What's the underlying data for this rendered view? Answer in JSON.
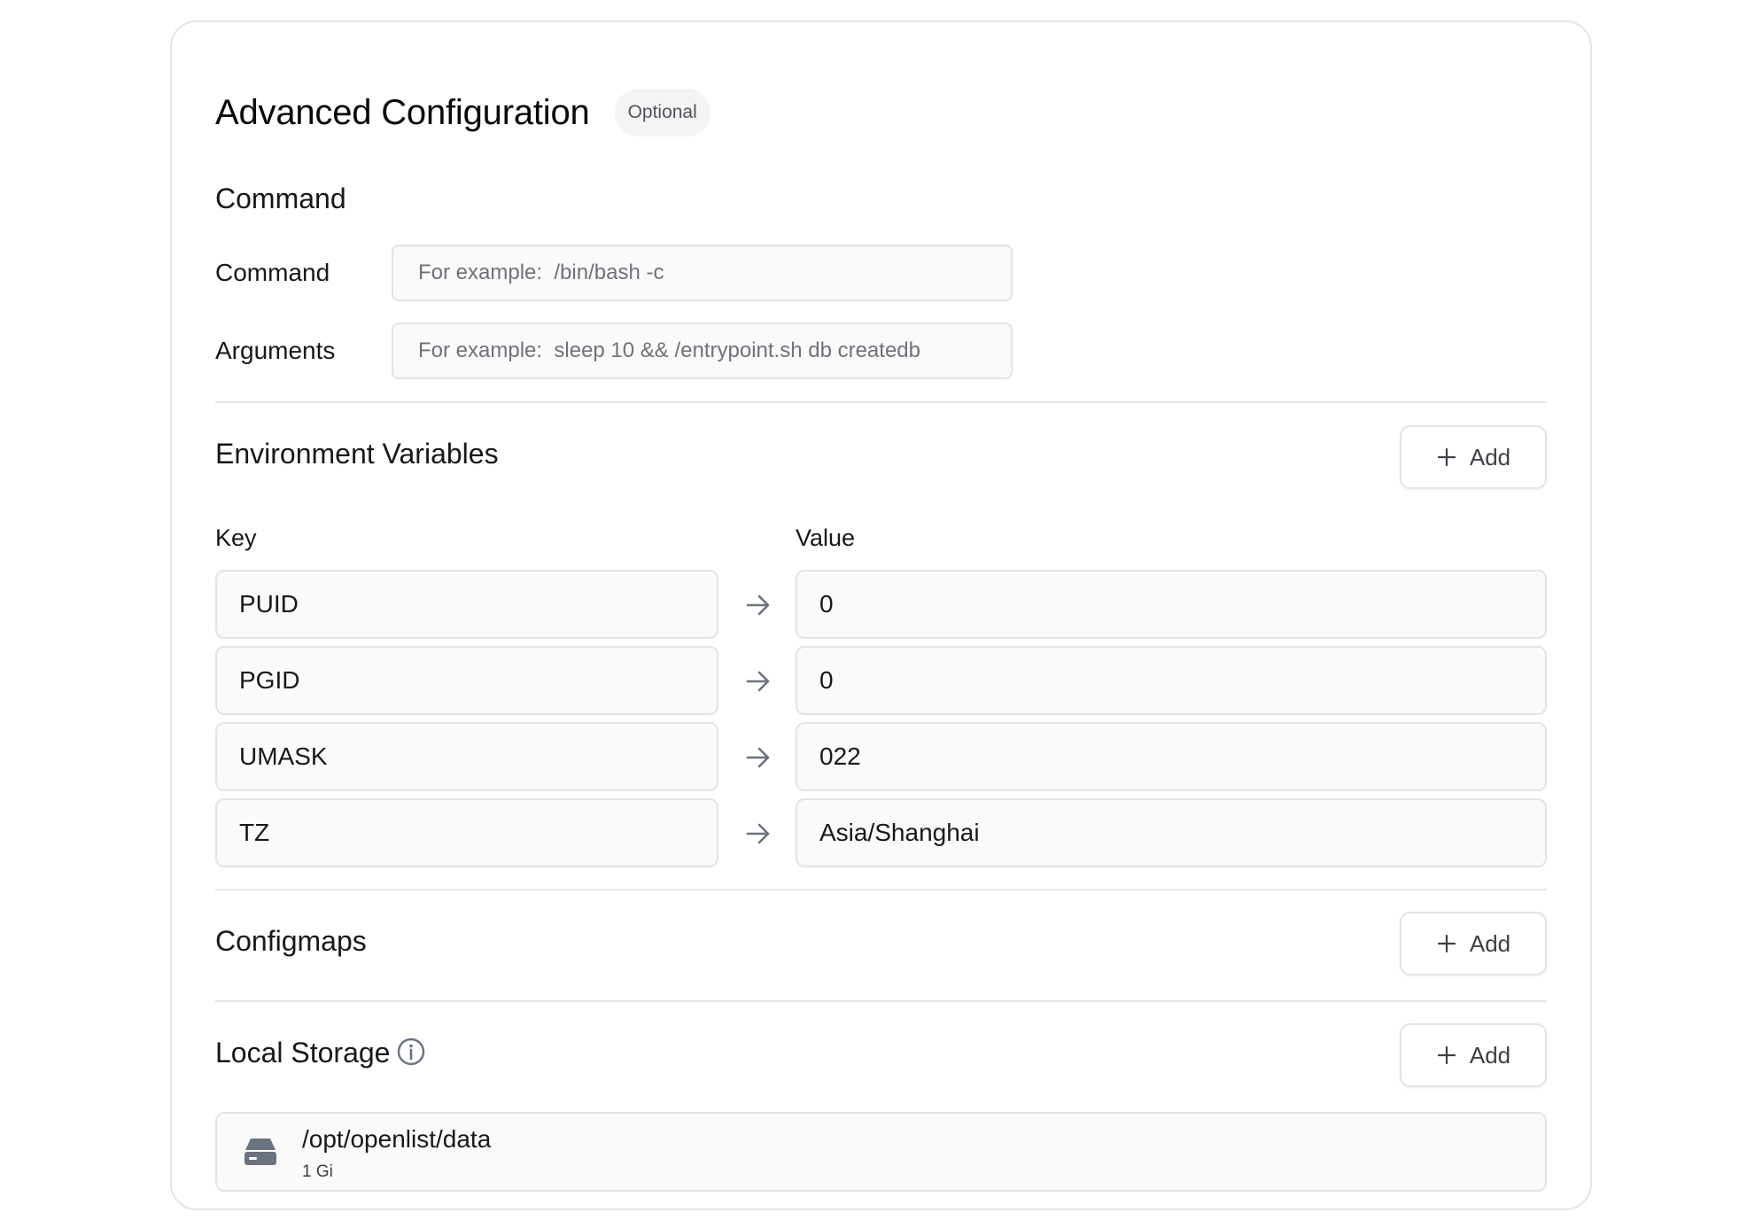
{
  "header": {
    "title": "Advanced Configuration",
    "badge": "Optional"
  },
  "command_section": {
    "title": "Command",
    "command_label": "Command",
    "command_placeholder": "For example:  /bin/bash -c",
    "command_value": "",
    "arguments_label": "Arguments",
    "arguments_placeholder": "For example:  sleep 10 && /entrypoint.sh db createdb",
    "arguments_value": ""
  },
  "env_section": {
    "title": "Environment Variables",
    "add_label": "Add",
    "key_header": "Key",
    "value_header": "Value",
    "rows": [
      {
        "key": "PUID",
        "value": "0"
      },
      {
        "key": "PGID",
        "value": "0"
      },
      {
        "key": "UMASK",
        "value": "022"
      },
      {
        "key": "TZ",
        "value": "Asia/Shanghai"
      }
    ]
  },
  "configmaps_section": {
    "title": "Configmaps",
    "add_label": "Add"
  },
  "storage_section": {
    "title": "Local Storage",
    "add_label": "Add",
    "items": [
      {
        "path": "/opt/openlist/data",
        "size": "1 Gi"
      }
    ]
  },
  "icons": {
    "add": "plus-icon",
    "env_arrow": "arrow-right-icon",
    "storage_info": "info-icon",
    "storage_item": "hard-drive-icon"
  },
  "colors": {
    "border": "#e4e4e7",
    "field_bg": "#fafafa",
    "text": "#18181b",
    "muted": "#71717a",
    "icon": "#6b7280"
  }
}
